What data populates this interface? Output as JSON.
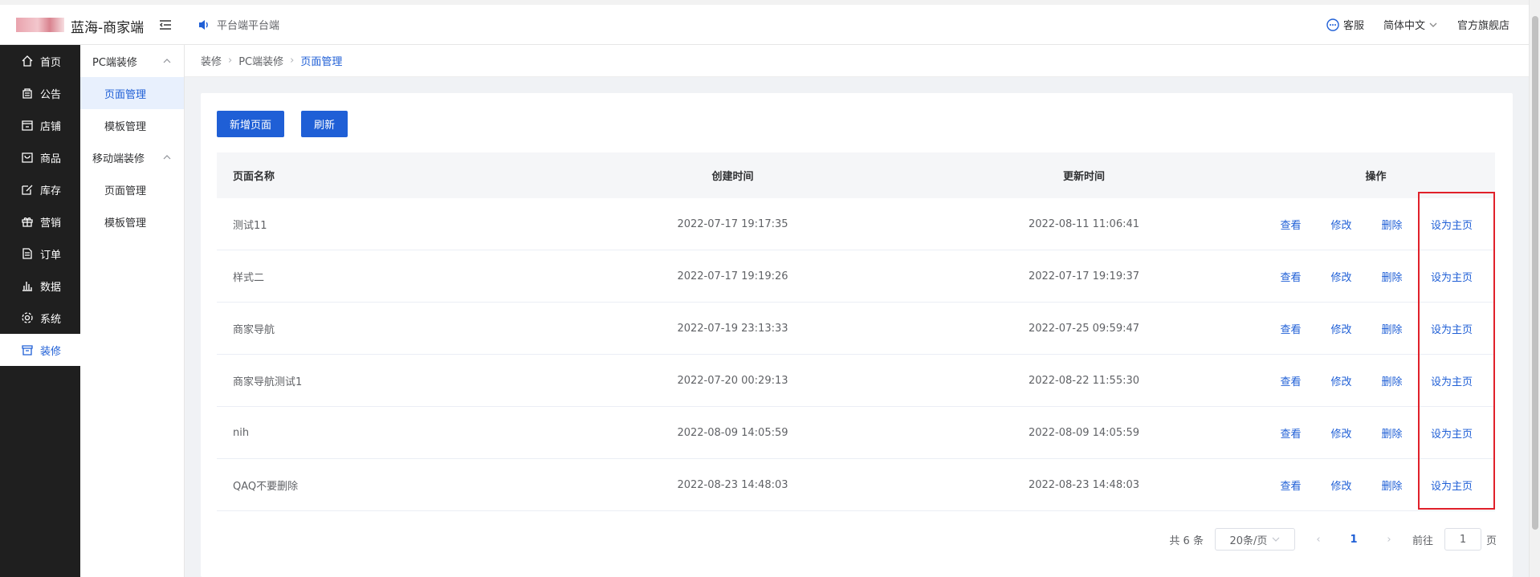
{
  "header": {
    "app_title": "蓝海-商家端",
    "notice": "平台端平台端",
    "service": "客服",
    "language": "简体中文",
    "store": "官方旗舰店"
  },
  "leftnav": {
    "items": [
      {
        "label": "首页",
        "icon": "home-icon"
      },
      {
        "label": "公告",
        "icon": "notice-icon"
      },
      {
        "label": "店铺",
        "icon": "shop-icon"
      },
      {
        "label": "商品",
        "icon": "goods-icon"
      },
      {
        "label": "库存",
        "icon": "edit-icon"
      },
      {
        "label": "营销",
        "icon": "gift-icon"
      },
      {
        "label": "订单",
        "icon": "order-icon"
      },
      {
        "label": "数据",
        "icon": "chart-icon"
      },
      {
        "label": "系统",
        "icon": "gear-icon"
      },
      {
        "label": "装修",
        "icon": "decor-icon"
      }
    ]
  },
  "subnav": {
    "group1": "PC端装修",
    "group1_items": [
      "页面管理",
      "模板管理"
    ],
    "group2": "移动端装修",
    "group2_items": [
      "页面管理",
      "模板管理"
    ]
  },
  "breadcrumb": [
    "装修",
    "PC端装修",
    "页面管理"
  ],
  "toolbar": {
    "add_label": "新增页面",
    "refresh_label": "刷新"
  },
  "table": {
    "columns": [
      "页面名称",
      "创建时间",
      "更新时间",
      "操作"
    ],
    "ops": [
      "查看",
      "修改",
      "删除",
      "设为主页"
    ],
    "rows": [
      {
        "name": "测试11",
        "created": "2022-07-17 19:17:35",
        "updated": "2022-08-11 11:06:41"
      },
      {
        "name": "样式二",
        "created": "2022-07-17 19:19:26",
        "updated": "2022-07-17 19:19:37"
      },
      {
        "name": "商家导航",
        "created": "2022-07-19 23:13:33",
        "updated": "2022-07-25 09:59:47"
      },
      {
        "name": "商家导航测试1",
        "created": "2022-07-20 00:29:13",
        "updated": "2022-08-22 11:55:30"
      },
      {
        "name": "nih",
        "created": "2022-08-09 14:05:59",
        "updated": "2022-08-09 14:05:59"
      },
      {
        "name": "QAQ不要删除",
        "created": "2022-08-23 14:48:03",
        "updated": "2022-08-23 14:48:03"
      }
    ]
  },
  "pager": {
    "total": "共 6 条",
    "page_size": "20条/页",
    "current_page": "1",
    "goto_prefix": "前往",
    "goto_value": "1",
    "goto_suffix": "页"
  },
  "colors": {
    "primary": "#1f5fd6",
    "sidebar_bg": "#1f1f1f",
    "highlight": "#e0202a"
  }
}
